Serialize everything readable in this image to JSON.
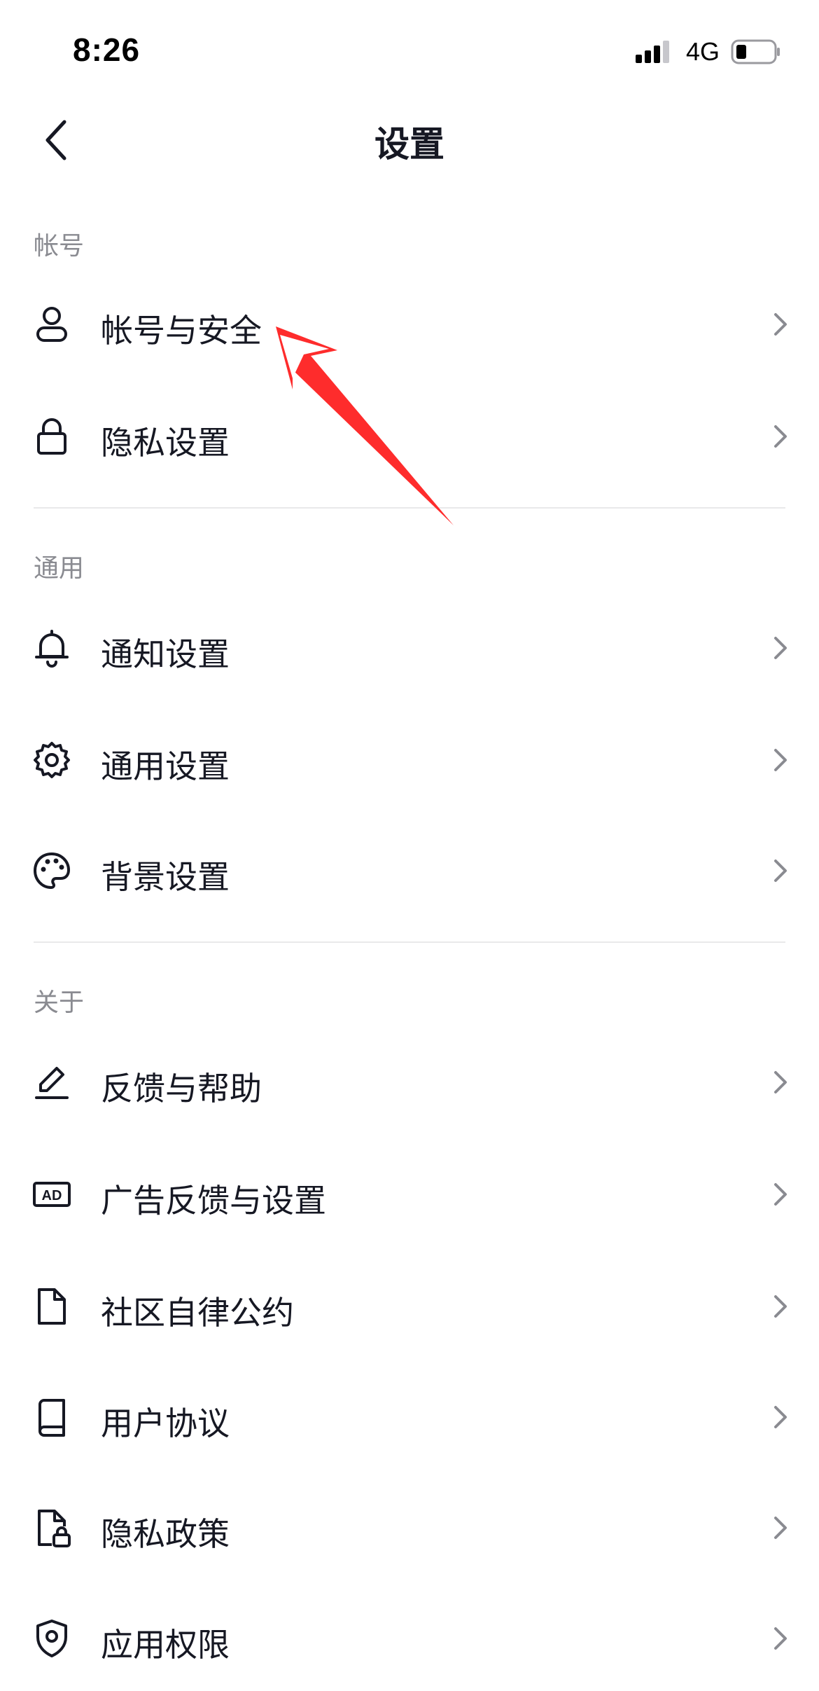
{
  "status_bar": {
    "time": "8:26",
    "network": "4G",
    "icons": [
      "signal-icon",
      "battery-icon"
    ]
  },
  "nav": {
    "title": "设置",
    "back_icon": "back-arrow-icon"
  },
  "sections": {
    "account": {
      "header": "帐号",
      "items": [
        {
          "label": "帐号与安全",
          "icon": "user-icon"
        },
        {
          "label": "隐私设置",
          "icon": "lock-icon"
        }
      ]
    },
    "general": {
      "header": "通用",
      "items": [
        {
          "label": "通知设置",
          "icon": "bell-icon"
        },
        {
          "label": "通用设置",
          "icon": "gear-icon"
        },
        {
          "label": "背景设置",
          "icon": "palette-icon"
        }
      ]
    },
    "about": {
      "header": "关于",
      "items": [
        {
          "label": "反馈与帮助",
          "icon": "edit-icon"
        },
        {
          "label": "广告反馈与设置",
          "icon": "ad-icon"
        },
        {
          "label": "社区自律公约",
          "icon": "document-icon"
        },
        {
          "label": "用户协议",
          "icon": "book-icon"
        },
        {
          "label": "隐私政策",
          "icon": "document-lock-icon"
        },
        {
          "label": "应用权限",
          "icon": "shield-icon"
        }
      ]
    }
  },
  "colors": {
    "text_primary": "#161823",
    "text_secondary": "#8a8b91",
    "chevron": "#8a8b91",
    "divider": "#e9e9ea",
    "annotation_arrow": "#fe2c2c"
  }
}
